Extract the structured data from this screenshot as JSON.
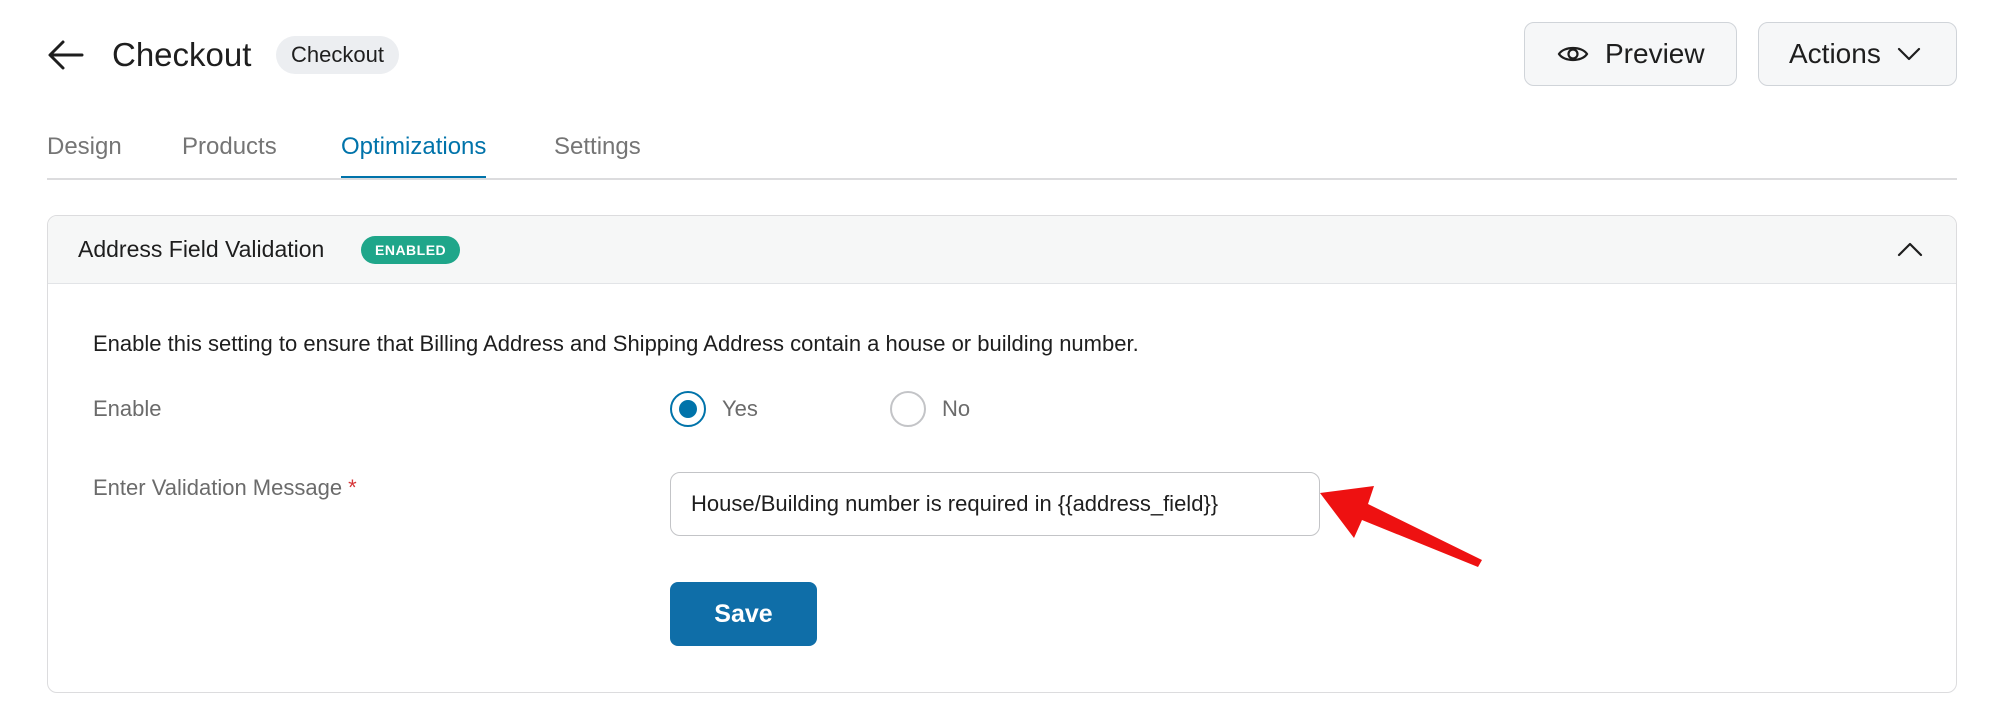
{
  "header": {
    "title": "Checkout",
    "badge": "Checkout",
    "preview_label": "Preview",
    "actions_label": "Actions"
  },
  "tabs": [
    {
      "label": "Design",
      "active": false
    },
    {
      "label": "Products",
      "active": false
    },
    {
      "label": "Optimizations",
      "active": true
    },
    {
      "label": "Settings",
      "active": false
    }
  ],
  "panel": {
    "title": "Address Field Validation",
    "status_badge": "ENABLED",
    "description": "Enable this setting to ensure that Billing Address and Shipping Address contain a house or building number.",
    "enable_label": "Enable",
    "options": [
      {
        "label": "Yes",
        "selected": true
      },
      {
        "label": "No",
        "selected": false
      }
    ],
    "message_label": "Enter Validation Message",
    "required_mark": "*",
    "message_value": "House/Building number is required in {{address_field}}",
    "save_label": "Save"
  },
  "colors": {
    "accent": "#0073aa",
    "save_button": "#0f6ea8",
    "enabled_badge": "#1fa68a",
    "annotation_arrow": "#ee1111",
    "required": "#d63638"
  },
  "icons": {
    "back": "arrow-left-icon",
    "preview": "eye-icon",
    "actions": "chevron-down-icon",
    "collapse": "chevron-up-icon",
    "annotation": "red-arrow-annotation"
  }
}
